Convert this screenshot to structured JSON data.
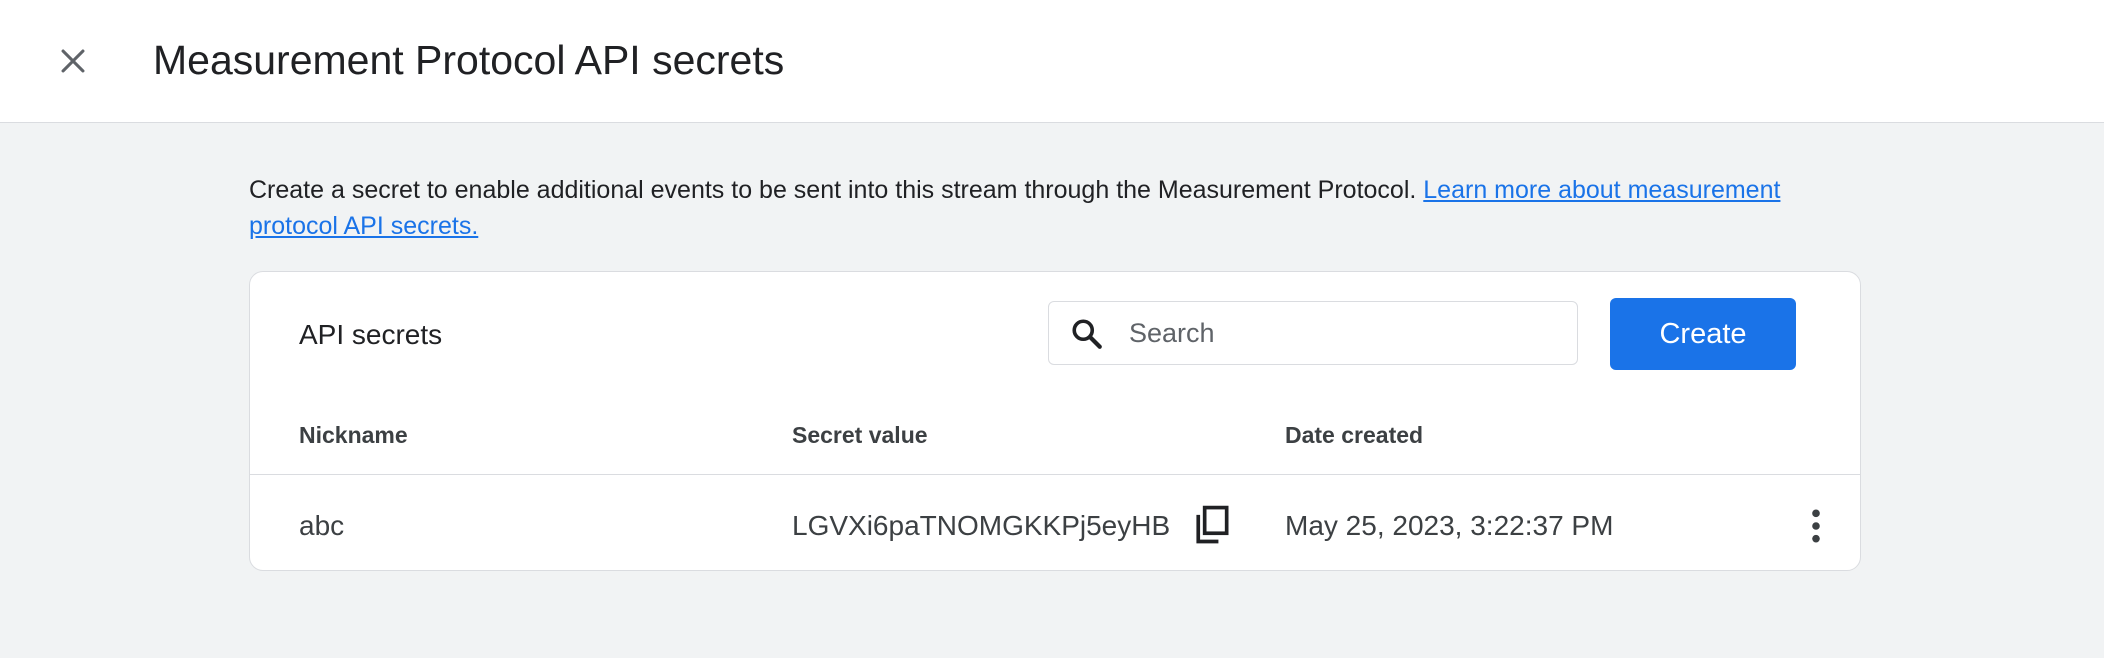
{
  "header": {
    "title": "Measurement Protocol API secrets",
    "close_icon": "close-icon"
  },
  "intro": {
    "text": "Create a secret to enable additional events to be sent into this stream through the Measurement Protocol. ",
    "link_text": "Learn more about measurement protocol API secrets."
  },
  "card": {
    "title": "API secrets",
    "search": {
      "placeholder": "Search",
      "value": "",
      "icon": "search-icon"
    },
    "create_label": "Create",
    "columns": [
      "Nickname",
      "Secret value",
      "Date created"
    ],
    "rows": [
      {
        "nickname": "abc",
        "secret_value": "LGVXi6paTNOMGKKPj5eyHB",
        "date_created": "May 25, 2023, 3:22:37 PM",
        "copy_icon": "copy-icon",
        "menu_icon": "more-vert-icon"
      }
    ]
  },
  "colors": {
    "accent": "#1a73e8",
    "background": "#f1f3f4",
    "surface": "#ffffff",
    "border": "#dadce0"
  }
}
